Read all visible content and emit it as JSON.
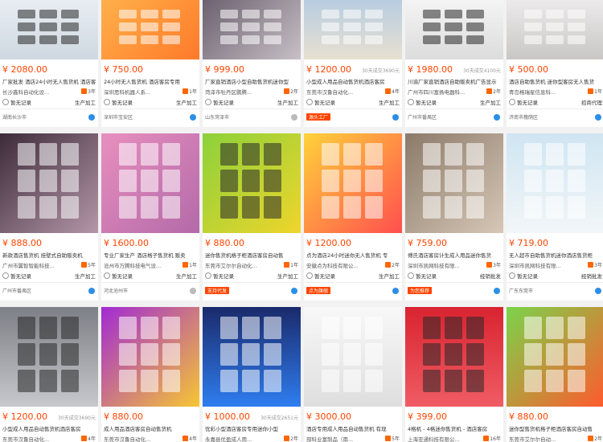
{
  "texts": {
    "no_record": "暂无记录",
    "mode_mfg": "生产加工",
    "mode_agent": "经销批发",
    "mode_agent2": "招商代理"
  },
  "cards": [
    {
      "price": "¥ 2080.00",
      "deal": "",
      "title": "厂家批发 酒店24小时无人售货机 酒店客房",
      "shop": "长沙鑫科自动化设...",
      "years": "3年",
      "mode": "生产加工",
      "loc": "湖南长沙市",
      "tag": ""
    },
    {
      "price": "¥ 750.00",
      "deal": "",
      "title": "24小时无人售货机 酒店客房专用",
      "shop": "深圳思科机器人系...",
      "years": "1年",
      "mode": "生产加工",
      "loc": "深圳市宝安区",
      "tag": ""
    },
    {
      "price": "¥ 999.00",
      "deal": "",
      "title": "厂家直销酒店小型自助售货机迷你型",
      "shop": "菏泽市牡丹区鹏腾...",
      "years": "2年",
      "mode": "生产加工",
      "loc": "山东菏泽市",
      "tag": ""
    },
    {
      "price": "¥ 1200.00",
      "deal": "30天成交3690元",
      "title": "小型成人用品自动售货机酒店客房",
      "shop": "东莞市汉鲁自动化...",
      "years": "4年",
      "mode": "生产加工",
      "loc": "",
      "tag": "源头工厂"
    },
    {
      "price": "¥ 1980.00",
      "deal": "30天成交4100元",
      "title": "川渝厂家直销酒店自助贩卖机广告显示",
      "shop": "广州市四川富扬电器科...",
      "years": "2年",
      "mode": "生产加工",
      "loc": "广州市番禺区",
      "tag": ""
    },
    {
      "price": "¥ 500.00",
      "deal": "",
      "title": "酒店自助售货机 迷你型客房无人售货",
      "shop": "青岛格瑞星信息科...",
      "years": "1年",
      "mode": "招商代理",
      "loc": "济南市槐荫区",
      "tag": ""
    },
    {
      "price": "¥ 888.00",
      "deal": "",
      "title": "新款酒店售货机 挂壁式自助贩卖机",
      "shop": "广州市翼智智能科技...",
      "years": "5年",
      "mode": "生产加工",
      "loc": "广州市番禺区",
      "tag": ""
    },
    {
      "price": "¥ 1600.00",
      "deal": "",
      "title": "专业厂家生产 酒店格子售货机 贩卖",
      "shop": "沧州市万腾科技电气设...",
      "years": "1年",
      "mode": "生产加工",
      "loc": "河北沧州市",
      "tag": ""
    },
    {
      "price": "¥ 880.00",
      "deal": "",
      "title": "迷你售货机格子柜酒店客房自动售",
      "shop": "东莞市艾尔尔自动化...",
      "years": "1年",
      "mode": "生产加工",
      "loc": "",
      "tag": "支持代发"
    },
    {
      "price": "¥ 1200.00",
      "deal": "",
      "title": "点为酒店24小时迷你无人售货机 专",
      "shop": "安徽点为科技有限公...",
      "years": "2年",
      "mode": "生产加工",
      "loc": "",
      "tag": "点为旗舰"
    },
    {
      "price": "¥ 759.00",
      "deal": "",
      "title": "傅氏酒店客房计生成人用品迷你售货",
      "shop": "深圳市凯网科技有限...",
      "years": "3年",
      "mode": "经销批发",
      "loc": "",
      "tag": "为您推荐"
    },
    {
      "price": "¥ 719.00",
      "deal": "",
      "title": "无人超市自助售货机迷你酒店售货柜",
      "shop": "深圳市凯网科技有限...",
      "years": "3年",
      "mode": "经销批发",
      "loc": "广东东莞市",
      "tag": ""
    },
    {
      "price": "¥ 1200.00",
      "deal": "30天成交3690元",
      "title": "小型成人用品自动售货机酒店客房",
      "shop": "东莞市汉鲁自动化...",
      "years": "4年",
      "mode": "",
      "loc": "",
      "tag": ""
    },
    {
      "price": "¥ 880.00",
      "deal": "",
      "title": "成人用品酒店客房自动售货机",
      "shop": "东莞市汉鲁自动化...",
      "years": "4年",
      "mode": "",
      "loc": "",
      "tag": ""
    },
    {
      "price": "¥ 1000.00",
      "deal": "30天成交2651元",
      "title": "优彩小型酒店客房专用迷你小型",
      "shop": "永嘉县优盈成人用...",
      "years": "2年",
      "mode": "",
      "loc": "",
      "tag": ""
    },
    {
      "price": "¥ 3000.00",
      "deal": "",
      "title": "酒店专用成人用品自动售货机 有现",
      "shop": "部科业富制品（南...",
      "years": "5年",
      "mode": "",
      "loc": "",
      "tag": ""
    },
    {
      "price": "¥ 399.00",
      "deal": "",
      "title": "4格机 - 4格迷你售货机 - 酒店客房",
      "shop": "上海亚通科技有限公...",
      "years": "16年",
      "mode": "",
      "loc": "",
      "tag": ""
    },
    {
      "price": "¥ 880.00",
      "deal": "",
      "title": "迷你型售货机格子柜酒店客房自动售",
      "shop": "东莞市艾尔尔自动...",
      "years": "2年",
      "mode": "",
      "loc": "",
      "tag": ""
    }
  ]
}
